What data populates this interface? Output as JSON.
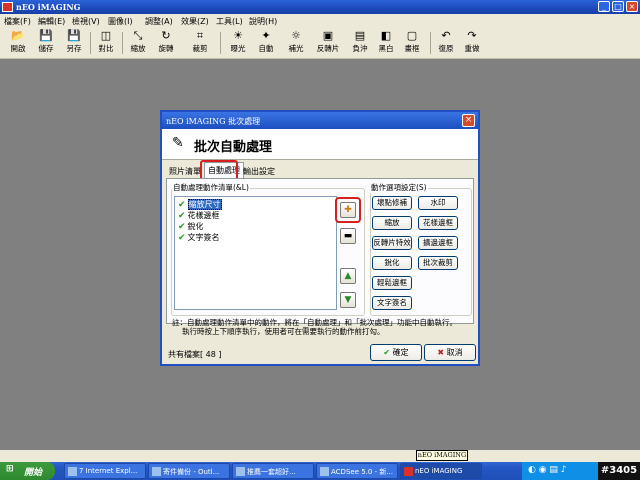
{
  "app": {
    "title": "nEO iMAGING"
  },
  "menu": [
    "檔案(F)",
    "編輯(E)",
    "檢視(V)",
    "圖像(I)",
    "調整(A)",
    "效果(Z)",
    "工具(L)",
    "說明(H)"
  ],
  "toolbar": [
    {
      "label": "開啟",
      "icon": "open-folder-icon",
      "glyph": "📂"
    },
    {
      "label": "儲存",
      "icon": "save-icon",
      "glyph": "💾"
    },
    {
      "label": "另存",
      "icon": "save-as-icon",
      "glyph": "💾"
    },
    {
      "label": "對比",
      "icon": "compare-icon",
      "glyph": "◫"
    },
    {
      "label": "縮放",
      "icon": "resize-icon",
      "glyph": "⤡"
    },
    {
      "label": "旋轉",
      "icon": "rotate-icon",
      "glyph": "↻"
    },
    {
      "label": "裁剪",
      "icon": "crop-icon",
      "glyph": "⌗"
    },
    {
      "label": "曝光",
      "icon": "exposure-icon",
      "glyph": "☀"
    },
    {
      "label": "自動",
      "icon": "auto-icon",
      "glyph": "✦"
    },
    {
      "label": "補光",
      "icon": "fill-light-icon",
      "glyph": "☼"
    },
    {
      "label": "反轉片",
      "icon": "reversal-film-icon",
      "glyph": "▣"
    },
    {
      "label": "負沖",
      "icon": "cross-process-icon",
      "glyph": "▤"
    },
    {
      "label": "黑白",
      "icon": "black-white-icon",
      "glyph": "◧"
    },
    {
      "label": "畫框",
      "icon": "frame-icon",
      "glyph": "▢"
    },
    {
      "label": "復原",
      "icon": "undo-icon",
      "glyph": "↶"
    },
    {
      "label": "重做",
      "icon": "redo-icon",
      "glyph": "↷"
    }
  ],
  "dialog": {
    "title": "nEO iMAGING 批次處理",
    "heading": "批次自動處理",
    "tabs": [
      "照片清單",
      "自動處理",
      "輸出設定"
    ],
    "list_label": "自動處理動作清單(&L)",
    "list_items": [
      {
        "label": "縮放尺寸",
        "checked": true,
        "selected": true
      },
      {
        "label": "花樣邊框",
        "checked": true
      },
      {
        "label": "銳化",
        "checked": true
      },
      {
        "label": "文字簽名",
        "checked": true
      }
    ],
    "actions_label": "動作選項設定(S)",
    "actions": [
      "壞點修補",
      "水印",
      "縮放",
      "花樣邊框",
      "反轉片特效",
      "擴邊邊框",
      "銳化",
      "批次裁剪",
      "輕鬆邊框",
      "文字簽名"
    ],
    "note_line1": "註：自動處理動作清單中的動作，將在「自動處理」和「批次處理」功能中自動執行。",
    "note_line2": "執行時按上下順序執行，使用者可在需要執行的動作前打勾。",
    "count": "共有檔案[ 48 ]",
    "ok": "確定",
    "cancel": "取消"
  },
  "taskbar": {
    "start": "開始",
    "tasks": [
      "7 Internet Expl...",
      "寄件備份 - Outl...",
      "推薦一套超好...",
      "ACDSee 5.0 - 新...",
      "nEO iMAGING"
    ],
    "tooltip": "nEO iMAGING"
  },
  "watermark": "#3405"
}
